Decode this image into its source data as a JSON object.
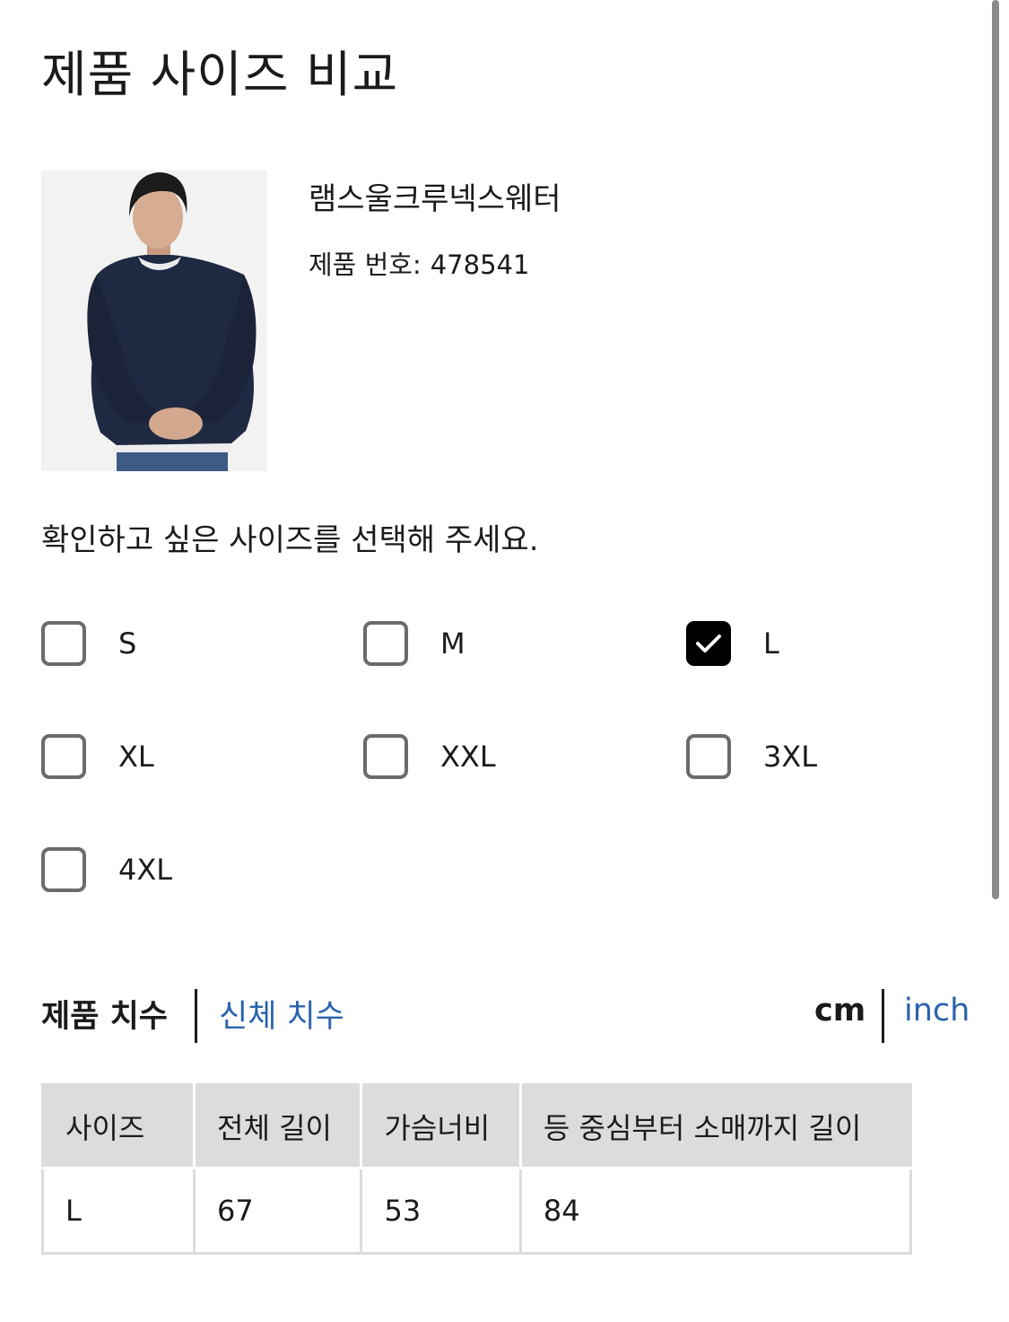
{
  "page_title": "제품 사이즈 비교",
  "product": {
    "name": "램스울크루넥스웨터",
    "number_label": "제품 번호:",
    "number": "478541"
  },
  "instruction": "확인하고 싶은 사이즈를 선택해 주세요.",
  "sizes": [
    {
      "label": "S",
      "checked": false
    },
    {
      "label": "M",
      "checked": false
    },
    {
      "label": "L",
      "checked": true
    },
    {
      "label": "XL",
      "checked": false
    },
    {
      "label": "XXL",
      "checked": false
    },
    {
      "label": "3XL",
      "checked": false
    },
    {
      "label": "4XL",
      "checked": false
    }
  ],
  "tabs": [
    {
      "label": "제품 치수",
      "active": true
    },
    {
      "label": "신체 치수",
      "active": false
    }
  ],
  "units": [
    {
      "label": "cm",
      "active": true
    },
    {
      "label": "inch",
      "active": false
    }
  ],
  "table": {
    "headers": [
      "사이즈",
      "전체 길이",
      "가슴너비",
      "등 중심부터 소매까지 길이"
    ],
    "rows": [
      [
        "L",
        "67",
        "53",
        "84"
      ]
    ]
  },
  "colors": {
    "link": "#2a63ad",
    "header_bg": "#dcdcdc",
    "checkbox_border": "#6b6b6b",
    "checked_bg": "#000000"
  }
}
